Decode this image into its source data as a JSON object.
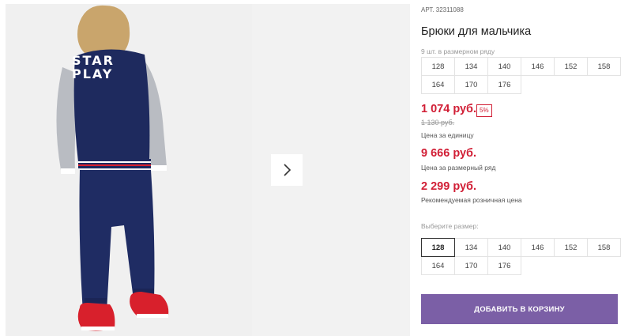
{
  "product": {
    "article_label": "АРТ.",
    "article_number": "32311088",
    "title": "Брюки для мальчика",
    "row_count": "9 шт. в размерном ряду",
    "row_sizes": [
      "128",
      "134",
      "140",
      "146",
      "152",
      "158",
      "164",
      "170",
      "176"
    ]
  },
  "gallery": {
    "jacket_text_line1": "STAR",
    "jacket_text_line2": "PLAY",
    "next_icon": "chevron-right-icon"
  },
  "pricing": {
    "unit_price": "1 074 руб.",
    "discount": "5%",
    "old_price": "1 130 руб.",
    "unit_price_note": "Цена за единицу",
    "row_price": "9 666 руб.",
    "row_price_note": "Цена за размерный ряд",
    "retail_price": "2 299 руб.",
    "retail_price_note": "Рекомендуемая розничная цена"
  },
  "size_picker": {
    "label": "Выберите размер:",
    "sizes": [
      "128",
      "134",
      "140",
      "146",
      "152",
      "158",
      "164",
      "170",
      "176"
    ],
    "selected": "128"
  },
  "actions": {
    "add_to_cart": "ДОБАВИТЬ В КОРЗИНУ"
  },
  "colors": {
    "price_red": "#d11e35",
    "button_purple": "#7b5fa6",
    "jacket_navy": "#1e2a5e",
    "sleeve_grey": "#b9bcc2",
    "sneaker_red": "#d8202c"
  }
}
